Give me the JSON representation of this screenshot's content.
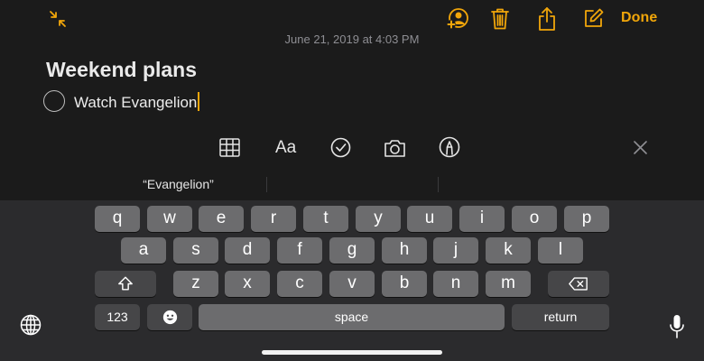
{
  "header": {
    "done_label": "Done",
    "accent_color": "#f1a60a",
    "icons": [
      "collapse-icon",
      "add-person-icon",
      "trash-icon",
      "share-icon",
      "compose-icon"
    ]
  },
  "note": {
    "timestamp": "June 21, 2019 at 4:03 PM",
    "title": "Weekend plans",
    "checklist": [
      {
        "text": "Watch Evangelion",
        "checked": false
      }
    ]
  },
  "format_toolbar": {
    "text_format_label": "Aa",
    "icons": [
      "table-icon",
      "checklist-icon",
      "camera-icon",
      "markup-icon",
      "close-icon"
    ]
  },
  "suggestions": [
    "“Evangelion”",
    "",
    ""
  ],
  "keyboard": {
    "row1": [
      "q",
      "w",
      "e",
      "r",
      "t",
      "y",
      "u",
      "i",
      "o",
      "p"
    ],
    "row2": [
      "a",
      "s",
      "d",
      "f",
      "g",
      "h",
      "j",
      "k",
      "l"
    ],
    "row3": [
      "z",
      "x",
      "c",
      "v",
      "b",
      "n",
      "m"
    ],
    "numbers_label": "123",
    "space_label": "space",
    "return_label": "return"
  }
}
